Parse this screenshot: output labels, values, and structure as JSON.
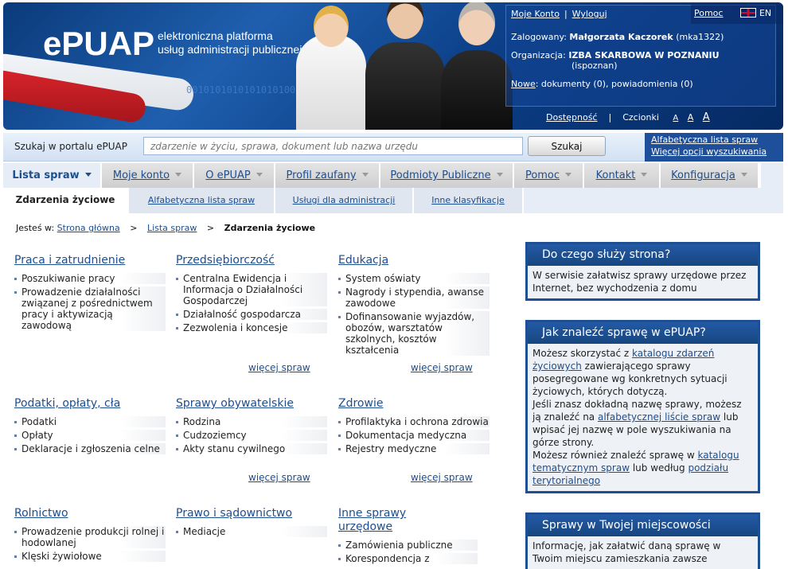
{
  "header": {
    "logo": "ePUAP",
    "tagline_line1": "elektroniczna platforma",
    "tagline_line2": "usług administracji publicznej",
    "binary": "0010101010101010100101"
  },
  "user": {
    "my_account": "Moje Konto",
    "logout": "Wyloguj",
    "help": "Pomoc",
    "lang": "EN",
    "logged_label": "Zalogowany:",
    "logged_name": "Małgorzata Kaczorek",
    "logged_id": "(mka1322)",
    "org_label": "Organizacja:",
    "org_name": "IZBA SKARBOWA W POZNANIU",
    "org_id": "(ispoznan)",
    "new_link": "Nowe",
    "new_text": ": dokumenty (0), powiadomienia (0)"
  },
  "accessibility": {
    "access": "Dostępność",
    "fonts_label": "Czcionki",
    "font_a1": "A",
    "font_a2": "A",
    "font_a3": "A"
  },
  "search": {
    "label": "Szukaj w portalu ePUAP",
    "placeholder": "zdarzenie w życiu, sprawa, dokument lub nazwa urzędu",
    "button": "Szukaj",
    "link1": "Alfabetyczna lista spraw",
    "link2": "Więcej opcji wyszukiwania"
  },
  "nav": {
    "tabs": [
      "Lista spraw",
      "Moje konto",
      "O ePUAP",
      "Profil zaufany",
      "Podmioty Publiczne",
      "Pomoc",
      "Kontakt",
      "Konfiguracja"
    ]
  },
  "subnav": {
    "tabs": [
      "Zdarzenia życiowe",
      "Alfabetyczna lista spraw",
      "Usługi dla administracji",
      "Inne klasyfikacje"
    ]
  },
  "breadcrumb": {
    "label": "Jesteś w:",
    "home": "Strona główna",
    "list": "Lista spraw",
    "current": "Zdarzenia życiowe"
  },
  "more_label": "więcej spraw",
  "categories": [
    {
      "title": "Praca i zatrudnienie",
      "items": [
        "Poszukiwanie pracy",
        "Prowadzenie działalności związanej z pośrednictwem pracy i aktywizacją zawodową"
      ]
    },
    {
      "title": "Przedsiębiorczość",
      "items": [
        "Centralna Ewidencja i Informacja o Działalności Gospodarczej",
        "Działalność gospodarcza",
        "Zezwolenia i koncesje"
      ]
    },
    {
      "title": "Edukacja",
      "items": [
        "System oświaty",
        "Nagrody i stypendia, awanse zawodowe",
        "Dofinansowanie wyjazdów, obozów, warsztatów szkolnych, kosztów kształcenia"
      ]
    },
    {
      "title": "Podatki, opłaty, cła",
      "items": [
        "Podatki",
        "Opłaty",
        "Deklaracje i zgłoszenia celne"
      ]
    },
    {
      "title": "Sprawy obywatelskie",
      "items": [
        "Rodzina",
        "Cudzoziemcy",
        "Akty stanu cywilnego"
      ]
    },
    {
      "title": "Zdrowie",
      "items": [
        "Profilaktyka i ochrona zdrowia",
        "Dokumentacja medyczna",
        "Rejestry medyczne"
      ]
    },
    {
      "title": "Rolnictwo",
      "items": [
        "Prowadzenie produkcji rolnej i hodowlanej",
        "Klęski żywiołowe"
      ]
    },
    {
      "title": "Prawo i sądownictwo",
      "items": [
        "Mediacje"
      ]
    },
    {
      "title": "Inne sprawy urzędowe",
      "items": [
        "Zamówienia publiczne",
        "Korespondencja z"
      ]
    }
  ],
  "sidebar": {
    "box1": {
      "title": "Do czego służy strona?",
      "text": "W serwisie załatwisz sprawy urzędowe przez Internet, bez wychodzenia z domu"
    },
    "box2": {
      "title": "Jak znaleźć sprawę w ePUAP?",
      "t1": "Możesz skorzystać z ",
      "l1": "katalogu zdarzeń życiowych",
      "t2": " zawierającego sprawy posegregowane wg konkretnych sytuacji życiowych, których dotyczą.",
      "t3": "Jeśli znasz dokładną nazwę sprawy, możesz ją znaleźć na ",
      "l2": "alfabetycznej liście spraw",
      "t4": " lub wpisać jej nazwę w pole wyszukiwania na górze strony.",
      "t5": "Możesz również znaleźć sprawę w ",
      "l3": "katalogu tematycznym spraw",
      "t6": " lub według ",
      "l4": "podziału terytorialnego"
    },
    "box3": {
      "title": "Sprawy w Twojej miejscowości",
      "text": "Informację, jak załatwić daną sprawę w Twoim miejscu zamieszkania zawsze"
    }
  }
}
